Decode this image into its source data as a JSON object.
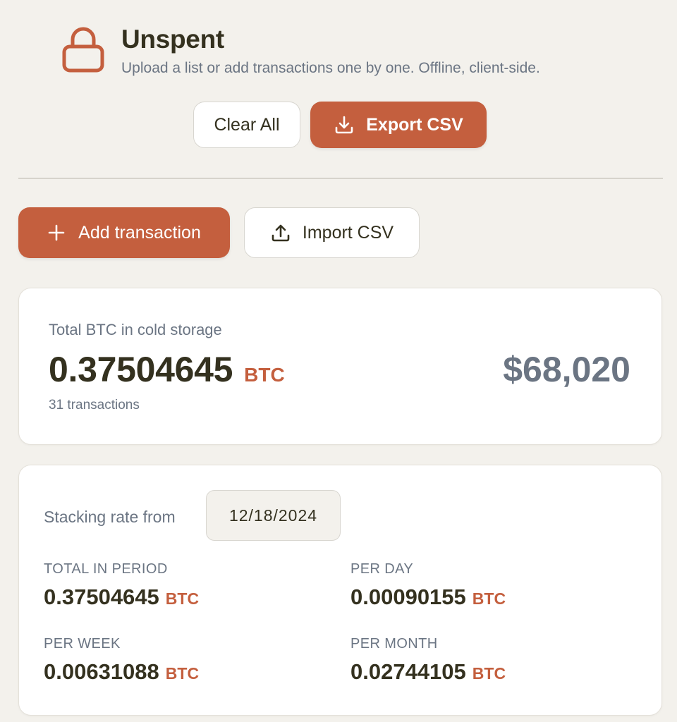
{
  "app": {
    "title": "Unspent",
    "subtitle": "Upload a list or add transactions one by one. Offline, client-side."
  },
  "header_actions": {
    "clear_label": "Clear All",
    "export_label": "Export CSV"
  },
  "actions": {
    "add_label": "Add transaction",
    "import_label": "Import CSV"
  },
  "total": {
    "label": "Total BTC in cold storage",
    "amount": "0.37504645",
    "unit": "BTC",
    "count": "31 transactions",
    "fiat": "$68,020"
  },
  "stacking": {
    "label": "Stacking rate from",
    "date": "12/18/2024",
    "stats": [
      {
        "label": "TOTAL IN PERIOD",
        "value": "0.37504645",
        "unit": "BTC"
      },
      {
        "label": "PER DAY",
        "value": "0.00090155",
        "unit": "BTC"
      },
      {
        "label": "PER WEEK",
        "value": "0.00631088",
        "unit": "BTC"
      },
      {
        "label": "PER MONTH",
        "value": "0.02744105",
        "unit": "BTC"
      }
    ]
  },
  "colors": {
    "accent": "#c45f3e",
    "background": "#f3f1ec",
    "text": "#34311f",
    "muted": "#6b7583"
  },
  "icons": [
    "lock-icon",
    "download-icon",
    "plus-icon",
    "upload-icon"
  ]
}
